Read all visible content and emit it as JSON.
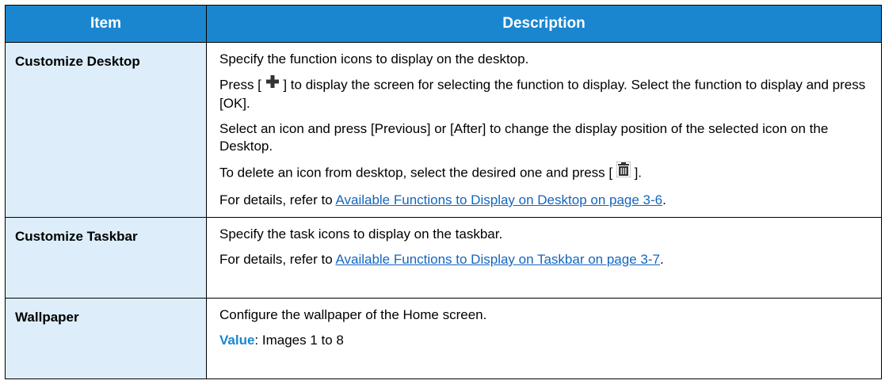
{
  "table": {
    "headers": {
      "item": "Item",
      "description": "Description"
    },
    "rows": [
      {
        "item": "Customize Desktop",
        "paragraphs": {
          "p1": "Specify the function icons to display on the desktop.",
          "p2_pre": "Press [ ",
          "p2_post": " ] to display the screen for selecting the function to display. Select the function to display and press [OK].",
          "p3": "Select an icon and press [Previous] or [After] to change the display position of the selected icon on the Desktop.",
          "p4_pre": "To delete an icon from desktop, select the desired one and press [ ",
          "p4_post": " ].",
          "p5_pre": "For details, refer to ",
          "p5_link": "Available Functions to Display on Desktop on page 3-6",
          "p5_post": "."
        },
        "icons": {
          "plus": "plus-icon",
          "trash": "trash-icon"
        }
      },
      {
        "item": "Customize Taskbar",
        "paragraphs": {
          "p1": "Specify the task icons to display on the taskbar.",
          "p2_pre": "For details, refer to ",
          "p2_link": "Available Functions to Display on Taskbar on page 3-7",
          "p2_post": "."
        }
      },
      {
        "item": "Wallpaper",
        "paragraphs": {
          "p1": "Configure the wallpaper of the Home screen.",
          "value_label": "Value",
          "value_text": ": Images 1 to 8"
        }
      }
    ]
  },
  "colors": {
    "header_bg": "#1a86d0",
    "item_bg": "#ddeefa",
    "link": "#1565c0",
    "value_label": "#1a86d0"
  }
}
